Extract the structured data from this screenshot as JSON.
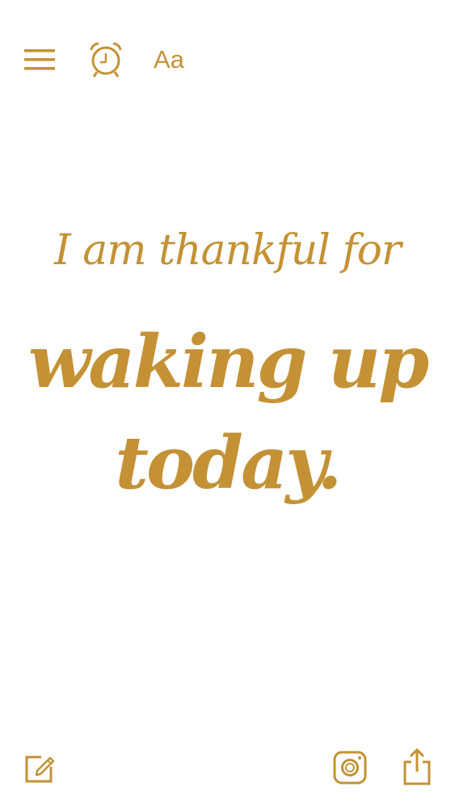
{
  "toolbar_top": {
    "menu_icon": "hamburger-menu-icon",
    "alarm_icon": "alarm-clock-icon",
    "font_label": "Aa"
  },
  "quote": {
    "intro": "I am thankful for",
    "line1": "waking up",
    "line2": "today."
  },
  "toolbar_bottom": {
    "compose_icon": "compose-icon",
    "instagram_icon": "instagram-icon",
    "share_icon": "share-icon"
  },
  "colors": {
    "accent": "#c49235",
    "background": "#ffffff"
  }
}
